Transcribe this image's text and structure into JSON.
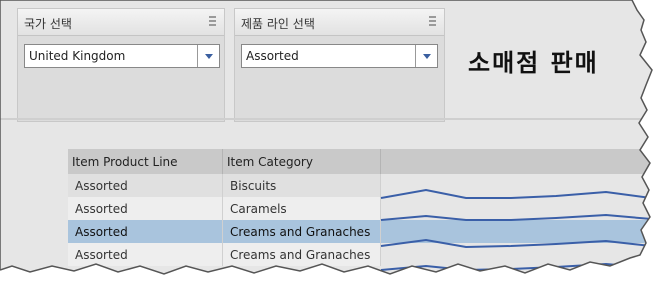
{
  "country_selector": {
    "title": "국가 선택",
    "value": "United Kingdom"
  },
  "product_selector": {
    "title": "제품 라인 선택",
    "value": "Assorted"
  },
  "heading": "소매점 판매",
  "table": {
    "columns": [
      "Item Product Line",
      "Item Category"
    ],
    "rows": [
      {
        "product_line": "Assorted",
        "category": "Biscuits",
        "selected": false
      },
      {
        "product_line": "Assorted",
        "category": "Caramels",
        "selected": false
      },
      {
        "product_line": "Assorted",
        "category": "Creams and Granaches",
        "selected": true
      },
      {
        "product_line": "Assorted",
        "category": "Creams and Granaches",
        "selected": false
      }
    ]
  },
  "colors": {
    "selected_row": "#a9c4dd",
    "sparkline": "#3a5fa8",
    "dropdown_arrow": "#3a5fa0"
  }
}
